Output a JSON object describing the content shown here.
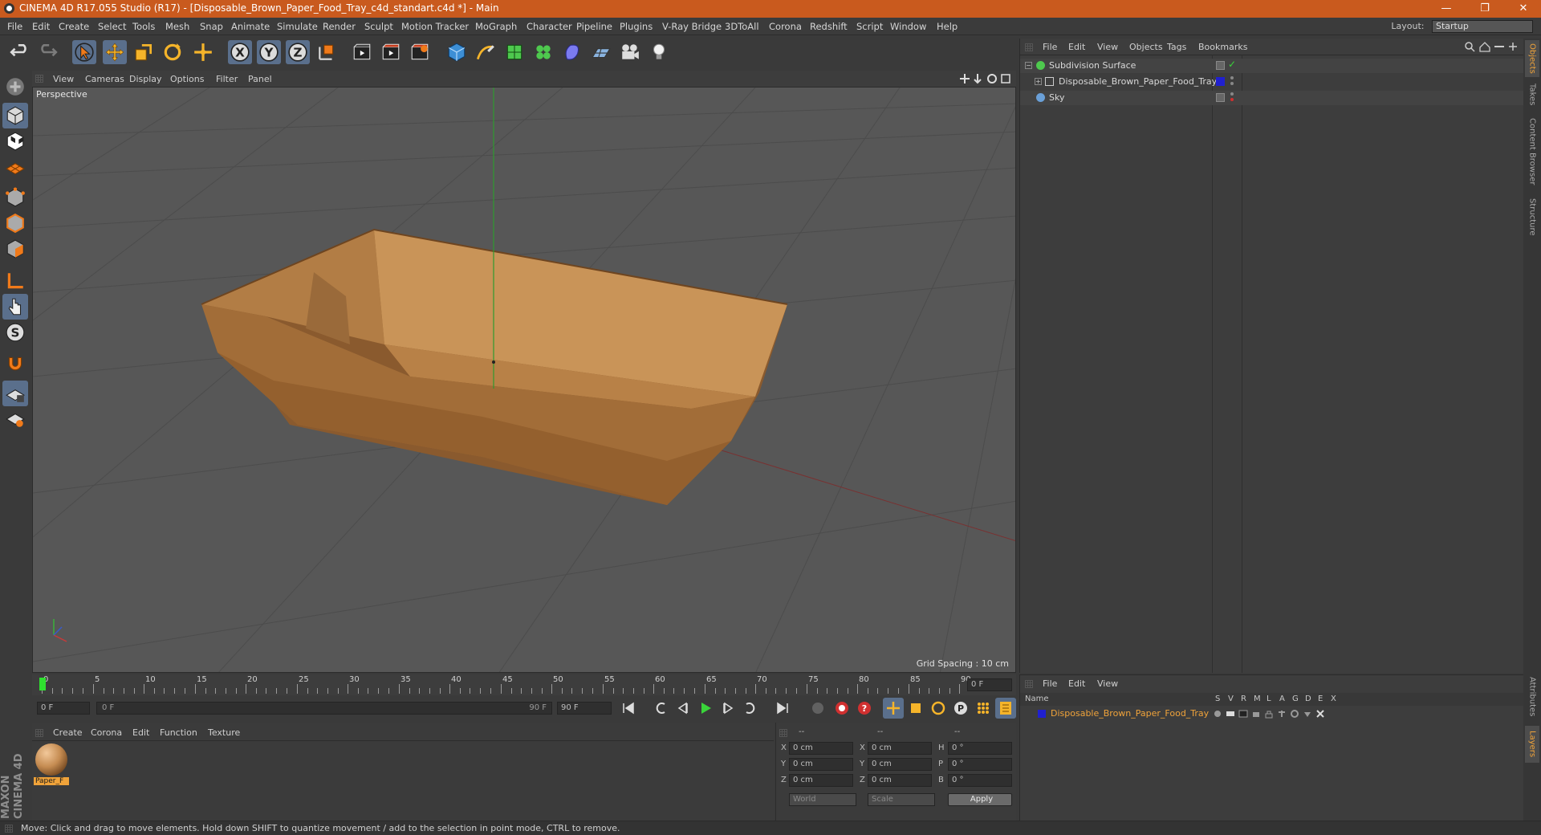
{
  "window": {
    "title": "CINEMA 4D R17.055 Studio (R17) - [Disposable_Brown_Paper_Food_Tray_c4d_standart.c4d *] - Main",
    "controls": {
      "minimize": "—",
      "restore": "❐",
      "close": "✕"
    }
  },
  "menubar": {
    "items": [
      "File",
      "Edit",
      "Create",
      "Select",
      "Tools",
      "Mesh",
      "Snap",
      "Animate",
      "Simulate",
      "Render",
      "Sculpt",
      "Motion Tracker",
      "MoGraph",
      "Character",
      "Pipeline",
      "Plugins",
      "V-Ray Bridge",
      "3DToAll",
      "Corona",
      "Redshift",
      "Script",
      "Window",
      "Help"
    ],
    "layout_label": "Layout:",
    "layout_value": "Startup"
  },
  "viewport": {
    "menu": [
      "View",
      "Cameras",
      "Display",
      "Options",
      "Filter",
      "Panel"
    ],
    "label": "Perspective",
    "grid_spacing": "Grid Spacing : 10 cm"
  },
  "timeline": {
    "ticks": [
      "0",
      "5",
      "10",
      "15",
      "20",
      "25",
      "30",
      "35",
      "40",
      "45",
      "50",
      "55",
      "60",
      "65",
      "70",
      "75",
      "80",
      "85",
      "90"
    ],
    "end_frame_field": "0 F",
    "current_frame": "0 F",
    "range_start": "0 F",
    "range_end": "90 F",
    "max_frame": "90 F"
  },
  "material_manager": {
    "menu": [
      "Create",
      "Corona",
      "Edit",
      "Function",
      "Texture"
    ],
    "materials": [
      {
        "name": "Paper_F"
      }
    ]
  },
  "coordinates": {
    "headers": [
      "--",
      "--",
      "--"
    ],
    "rows": [
      {
        "axis": "X",
        "pos": "0 cm",
        "axis2": "X",
        "size": "0 cm",
        "rot_axis": "H",
        "rot": "0 °"
      },
      {
        "axis": "Y",
        "pos": "0 cm",
        "axis2": "Y",
        "size": "0 cm",
        "rot_axis": "P",
        "rot": "0 °"
      },
      {
        "axis": "Z",
        "pos": "0 cm",
        "axis2": "Z",
        "size": "0 cm",
        "rot_axis": "B",
        "rot": "0 °"
      }
    ],
    "mode1": "World",
    "mode2": "Scale",
    "apply": "Apply"
  },
  "object_manager": {
    "menu": [
      "File",
      "Edit",
      "View",
      "Objects",
      "Tags",
      "Bookmarks"
    ],
    "objects": [
      {
        "name": "Subdivision Surface",
        "color": "#4ec94e"
      },
      {
        "name": "Disposable_Brown_Paper_Food_Tray",
        "color": "#2020d0"
      },
      {
        "name": "Sky",
        "color": "#6aa0d8"
      }
    ]
  },
  "layer_manager": {
    "menu": [
      "File",
      "Edit",
      "View"
    ],
    "header_name": "Name",
    "header_flags": [
      "S",
      "V",
      "R",
      "M",
      "L",
      "A",
      "G",
      "D",
      "E",
      "X"
    ],
    "layers": [
      {
        "name": "Disposable_Brown_Paper_Food_Tray",
        "color": "#2020d0"
      }
    ]
  },
  "side_tabs": [
    "Objects",
    "Takes",
    "Content Browser",
    "Structure",
    "Attributes",
    "Layers"
  ],
  "status": "Move: Click and drag to move elements. Hold down SHIFT to quantize movement / add to the selection in point mode, CTRL to remove.",
  "brand": "MAXON CINEMA 4D",
  "colors": {
    "accent": "#c95a1e",
    "active_tool": "#5a6f8c",
    "highlight_text": "#f0a33a",
    "tray": "#c58c52"
  }
}
